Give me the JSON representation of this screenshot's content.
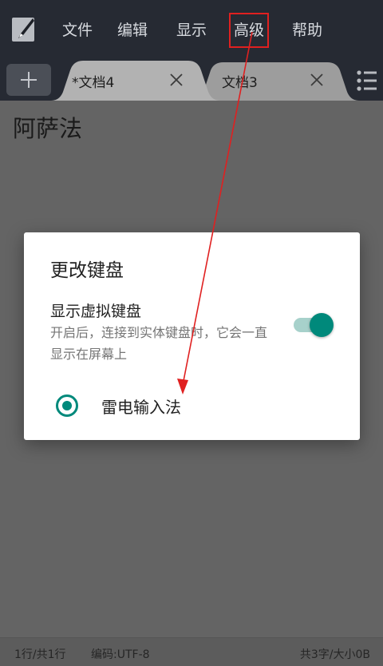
{
  "menubar": {
    "items": [
      {
        "label": "文件"
      },
      {
        "label": "编辑"
      },
      {
        "label": "显示"
      },
      {
        "label": "高级"
      },
      {
        "label": "帮助"
      }
    ]
  },
  "tabs": [
    {
      "label": "*文档4",
      "active": true
    },
    {
      "label": "文档3",
      "active": false
    }
  ],
  "editor": {
    "content": "阿萨法"
  },
  "dialog": {
    "title": "更改键盘",
    "setting_title": "显示虚拟键盘",
    "setting_desc": "开启后，连接到实体键盘时，它会一直显示在屏幕上",
    "toggle_on": true,
    "options": [
      {
        "label": "雷电输入法",
        "selected": true
      }
    ]
  },
  "status": {
    "line": "1行/共1行",
    "encoding": "编码:UTF-8",
    "size": "共3字/大小0B"
  },
  "colors": {
    "accent": "#00897b",
    "menubar_bg": "#262a33",
    "annotation": "#e02020"
  }
}
